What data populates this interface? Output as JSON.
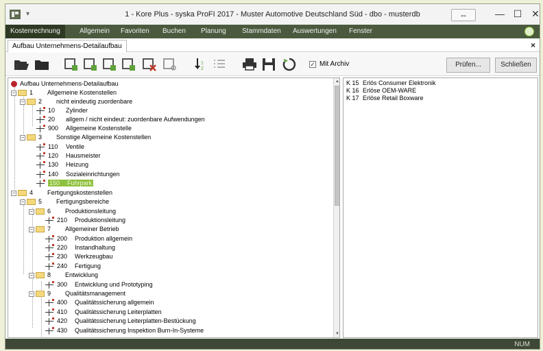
{
  "window": {
    "title": "1 - Kore Plus - syska ProFI 2017 - Muster Automotive Deutschland Süd - dbo - musterdb",
    "swap_icon": "⇔",
    "minimize": "—",
    "maximize": "☐",
    "close": "✕"
  },
  "menu": {
    "items": [
      "Kostenrechnung",
      "Allgemein",
      "Favoriten",
      "Buchen",
      "Planung",
      "Stammdaten",
      "Auswertungen",
      "Fenster"
    ]
  },
  "document_tab": {
    "label": "Aufbau Unternehmens-Detailaufbau",
    "close": "×"
  },
  "toolbar": {
    "archiv_label": "Mit Archiv",
    "archiv_checked": "✓",
    "pruefen_label": "Prüfen...",
    "schliessen_label": "Schließen"
  },
  "tree": {
    "rows": [
      {
        "code": "",
        "label": "Aufbau Unternehmens-Detailaufbau"
      },
      {
        "code": "1",
        "label": "Allgemeine Kostenstellen"
      },
      {
        "code": "2",
        "label": "nicht eindeutig zuordenbare"
      },
      {
        "code": "10",
        "label": "Zylinder"
      },
      {
        "code": "20",
        "label": "allgem / nicht eindeut: zuordenbare Aufwendungen"
      },
      {
        "code": "900",
        "label": "Allgemeine Kostenstelle"
      },
      {
        "code": "3",
        "label": "Sonstige Allgemeine Kostenstellen"
      },
      {
        "code": "110",
        "label": "Ventile"
      },
      {
        "code": "120",
        "label": "Hausmeister"
      },
      {
        "code": "130",
        "label": "Heizung"
      },
      {
        "code": "140",
        "label": "Sozialeinrichtungen"
      },
      {
        "code": "150",
        "label": "Fuhrpark"
      },
      {
        "code": "4",
        "label": "Fertigungskostenstellen"
      },
      {
        "code": "5",
        "label": "Fertigungsbereiche"
      },
      {
        "code": "6",
        "label": "Produktionsleitung"
      },
      {
        "code": "210",
        "label": "Produktionsleitung"
      },
      {
        "code": "7",
        "label": "Allgemeiner Betrieb"
      },
      {
        "code": "200",
        "label": "Produktion allgemein"
      },
      {
        "code": "220",
        "label": "Instandhaltung"
      },
      {
        "code": "230",
        "label": "Werkzeugbau"
      },
      {
        "code": "240",
        "label": "Fertigung"
      },
      {
        "code": "8",
        "label": "Entwicklung"
      },
      {
        "code": "300",
        "label": "Entwicklung und Prototyping"
      },
      {
        "code": "9",
        "label": "Qualitätsmanagement"
      },
      {
        "code": "400",
        "label": "Qualitätssicherung allgemein"
      },
      {
        "code": "410",
        "label": "Qualitätssicherung Leiterplatten"
      },
      {
        "code": "420",
        "label": "Qualitätssicherung Leiterplatten-Bestückung"
      },
      {
        "code": "430",
        "label": "Qualitätssicherung Inspektion Burn-In-Systeme"
      }
    ]
  },
  "right_list": {
    "items": [
      {
        "code": "K 15",
        "label": "Erlös Consumer Elektronik"
      },
      {
        "code": "K 16",
        "label": "Erlöse OEM-WARE"
      },
      {
        "code": "K 17",
        "label": "Erlöse Retail Boxware"
      }
    ]
  },
  "status": {
    "num": "NUM"
  },
  "colors": {
    "menubar": "#4b5a3e",
    "statusbar": "#3e4836",
    "selection": "#8fc13f",
    "accent_green": "#5fa23a",
    "accent_red": "#c0392b"
  },
  "icons": [
    "app-icon",
    "open-folder-icon",
    "folder-icon",
    "add-node-icon",
    "delete-node-icon",
    "search-node-icon",
    "sort-icon",
    "list-icon",
    "print-icon",
    "save-icon",
    "refresh-icon",
    "help-icon"
  ]
}
